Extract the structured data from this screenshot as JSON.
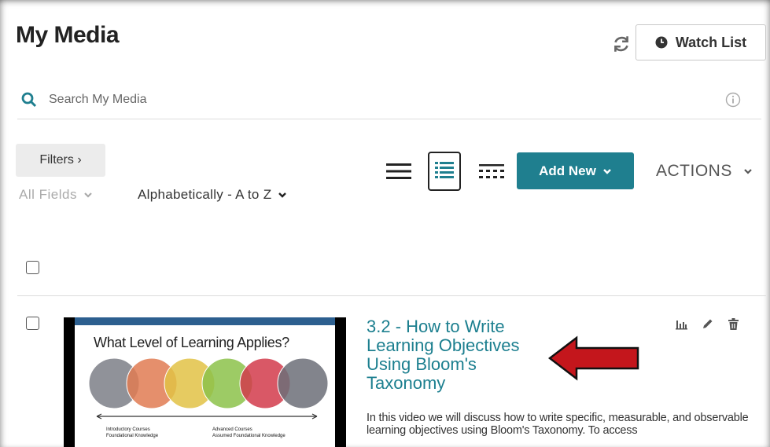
{
  "header": {
    "title": "My Media",
    "watch_list_label": "Watch List"
  },
  "search": {
    "placeholder": "Search My Media",
    "value": ""
  },
  "toolbar": {
    "filters_label": "Filters  ›",
    "field_select": "All Fields",
    "sort_select": "Alphabetically - A to Z",
    "add_new_label": "Add New",
    "actions_label": "ACTIONS",
    "accent_color": "#1f7f8f"
  },
  "icons": {
    "refresh": "refresh-icon",
    "watch": "clock-icon",
    "search": "search-icon",
    "info": "info-icon",
    "views": [
      "list-view-icon",
      "detailed-view-icon",
      "grid-view-icon"
    ],
    "row_actions": [
      "analytics-icon",
      "edit-icon",
      "delete-icon"
    ]
  },
  "entries": [
    {
      "title": "3.2 - How to Write Learning Objectives Using Bloom's Taxonomy",
      "description": "In this video we will discuss how to write specific, measurable, and observable learning objectives using Bloom's Taxonomy. To access",
      "thumbnail": {
        "heading": "What Level of Learning Applies?",
        "circle_colors": [
          "#7d7f87",
          "#e07b52",
          "#e2c245",
          "#8cc24a",
          "#d23b4b",
          "#6c6f78"
        ],
        "left_caption_1": "Introductory Courses",
        "left_caption_2": "Foundational Knowledge",
        "right_caption_1": "Advanced Courses",
        "right_caption_2": "Assumed Foundational Knowledge"
      }
    }
  ],
  "annotation": {
    "arrow_color": "#c4161c"
  }
}
